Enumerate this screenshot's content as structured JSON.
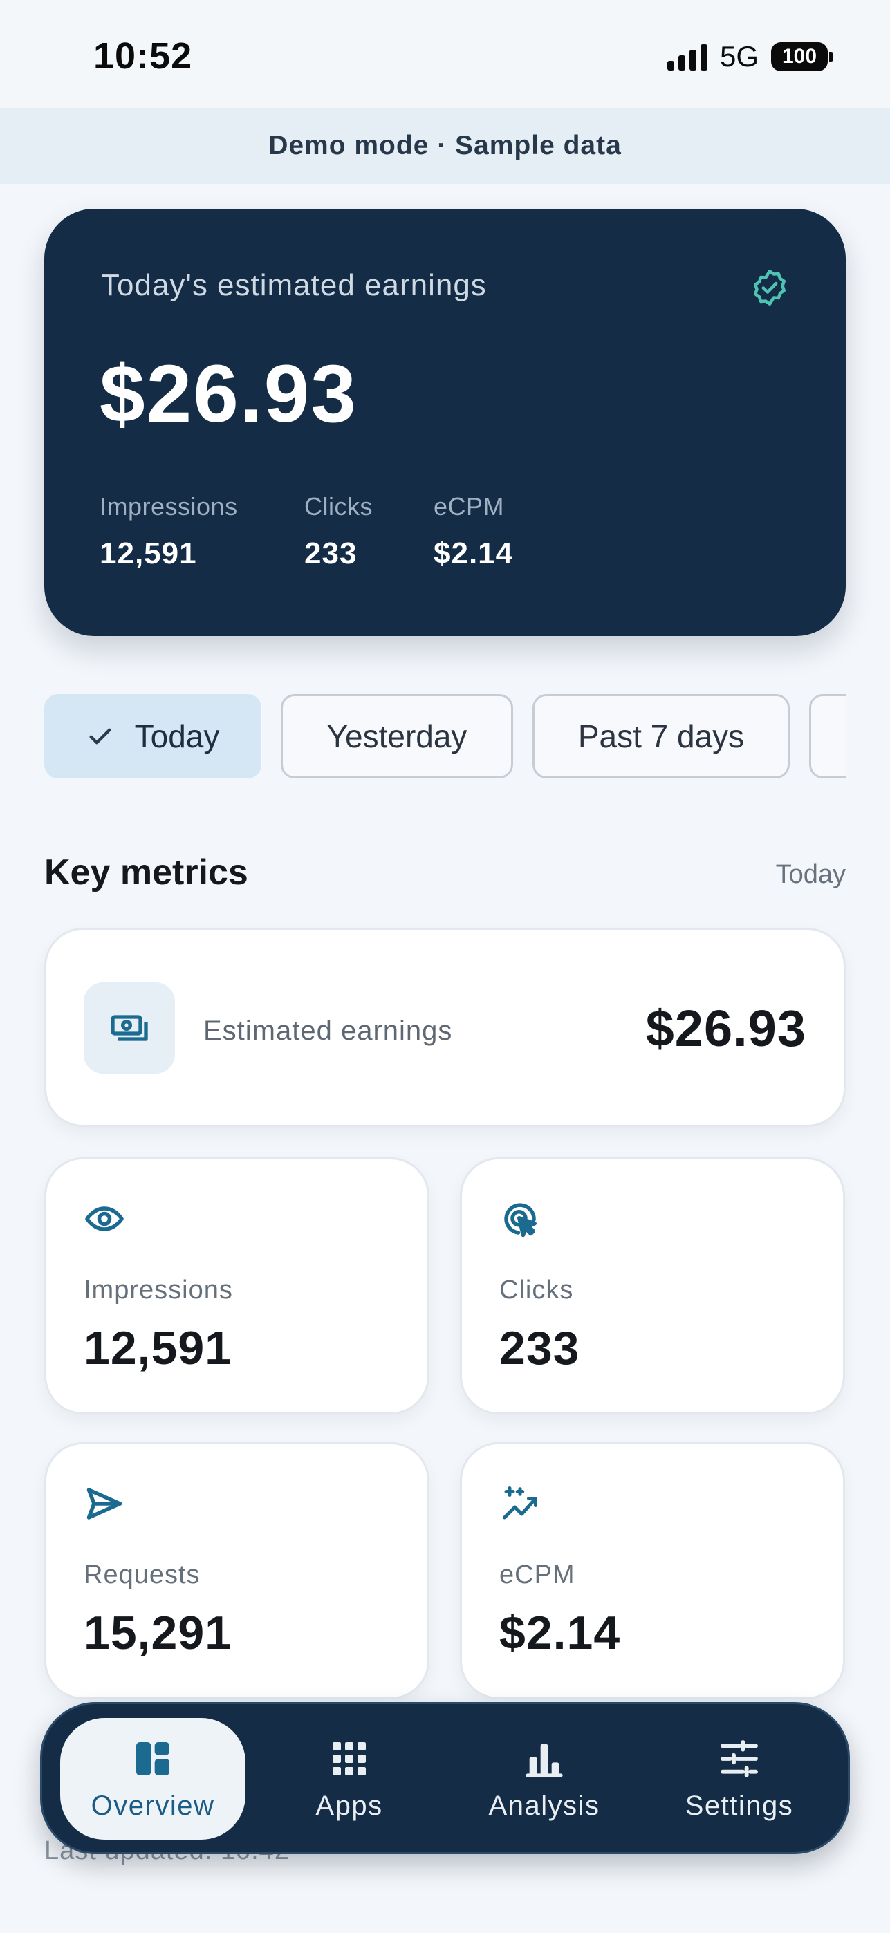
{
  "status_bar": {
    "time": "10:52",
    "network": "5G",
    "battery": "100"
  },
  "banner": {
    "text": "Demo mode · Sample data"
  },
  "hero": {
    "label": "Today's estimated earnings",
    "amount": "$26.93",
    "stats": [
      {
        "label": "Impressions",
        "value": "12,591"
      },
      {
        "label": "Clicks",
        "value": "233"
      },
      {
        "label": "eCPM",
        "value": "$2.14"
      }
    ]
  },
  "filters": [
    {
      "label": "Today",
      "selected": true
    },
    {
      "label": "Yesterday",
      "selected": false
    },
    {
      "label": "Past 7 days",
      "selected": false
    }
  ],
  "key_metrics": {
    "title": "Key metrics",
    "range": "Today",
    "earnings": {
      "label": "Estimated earnings",
      "value": "$26.93",
      "icon": "money-icon"
    },
    "cards": [
      {
        "label": "Impressions",
        "value": "12,591",
        "icon": "eye-icon"
      },
      {
        "label": "Clicks",
        "value": "233",
        "icon": "cursor-click-icon"
      },
      {
        "label": "Requests",
        "value": "15,291",
        "icon": "send-icon"
      },
      {
        "label": "eCPM",
        "value": "$2.14",
        "icon": "sparkle-trend-icon"
      }
    ]
  },
  "footer": {
    "last_updated": "Last updated: 10:42"
  },
  "nav": {
    "items": [
      {
        "label": "Overview",
        "icon": "dashboard-icon",
        "active": true
      },
      {
        "label": "Apps",
        "icon": "apps-grid-icon",
        "active": false
      },
      {
        "label": "Analysis",
        "icon": "bar-chart-icon",
        "active": false
      },
      {
        "label": "Settings",
        "icon": "sliders-icon",
        "active": false
      }
    ]
  },
  "colors": {
    "hero_bg": "#142c45",
    "accent": "#1b6a8f",
    "chip_active": "#d5e6f5",
    "badge": "#4fc3b4"
  }
}
